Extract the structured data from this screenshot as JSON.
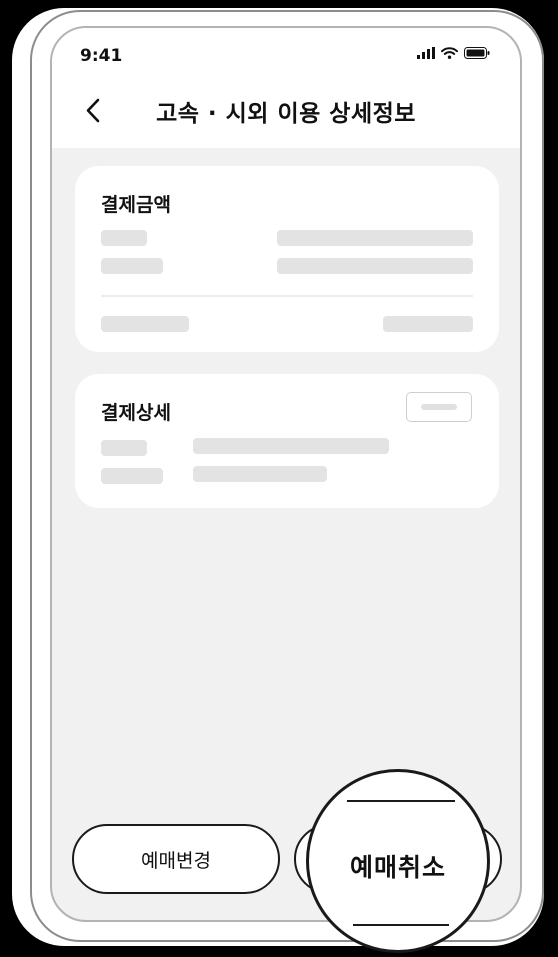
{
  "status_bar": {
    "time": "9:41"
  },
  "header": {
    "title": "고속 · 시외 이용 상세정보"
  },
  "payment_amount": {
    "title": "결제금액"
  },
  "payment_details": {
    "title": "결제상세"
  },
  "actions": {
    "change_label": "예매변경",
    "cancel_label": "예매취소"
  },
  "colors": {
    "screen_background": "#f1f1f1",
    "card_background": "#ffffff",
    "placeholder": "#e3e3e3",
    "button_border": "#1a1a1a"
  },
  "icons": {
    "back": "chevron-left-icon",
    "signal": "cellular-signal-icon",
    "wifi": "wifi-icon",
    "battery": "battery-icon"
  }
}
